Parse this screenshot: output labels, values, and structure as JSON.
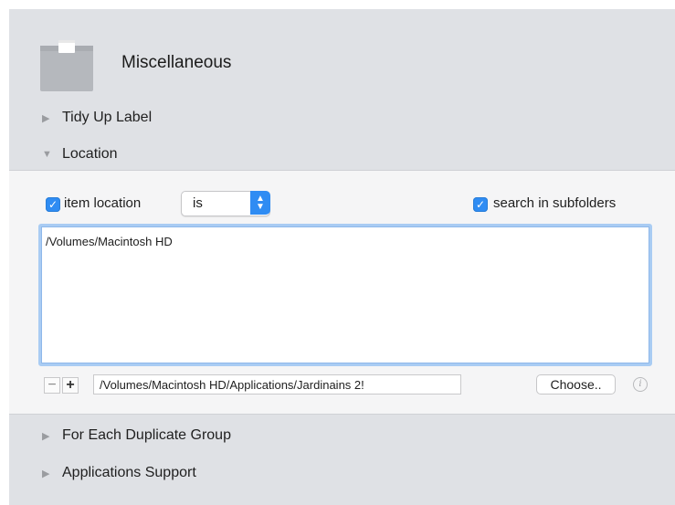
{
  "header": {
    "title": "Miscellaneous",
    "icon": "box-icon"
  },
  "sections": {
    "tidy_up_label": "Tidy Up Label",
    "location": "Location",
    "for_each_duplicate_group": "For Each Duplicate Group",
    "applications_support": "Applications Support"
  },
  "location_panel": {
    "item_location_label": "item location",
    "item_location_checked": true,
    "operator_value": "is",
    "search_subfolders_label": "search in subfolders",
    "search_subfolders_checked": true,
    "paths": [
      "/Volumes/Macintosh HD"
    ],
    "path_field_value": "/Volumes/Macintosh HD/Applications/Jardinains 2!",
    "minus_label": "−",
    "plus_label": "+",
    "choose_label": "Choose..",
    "info_glyph": "i"
  },
  "colors": {
    "accent": "#2f8cf3",
    "panel_bg": "#dfe1e5",
    "expanded_bg": "#f5f5f6",
    "focus_ring": "#a9ccf3"
  }
}
